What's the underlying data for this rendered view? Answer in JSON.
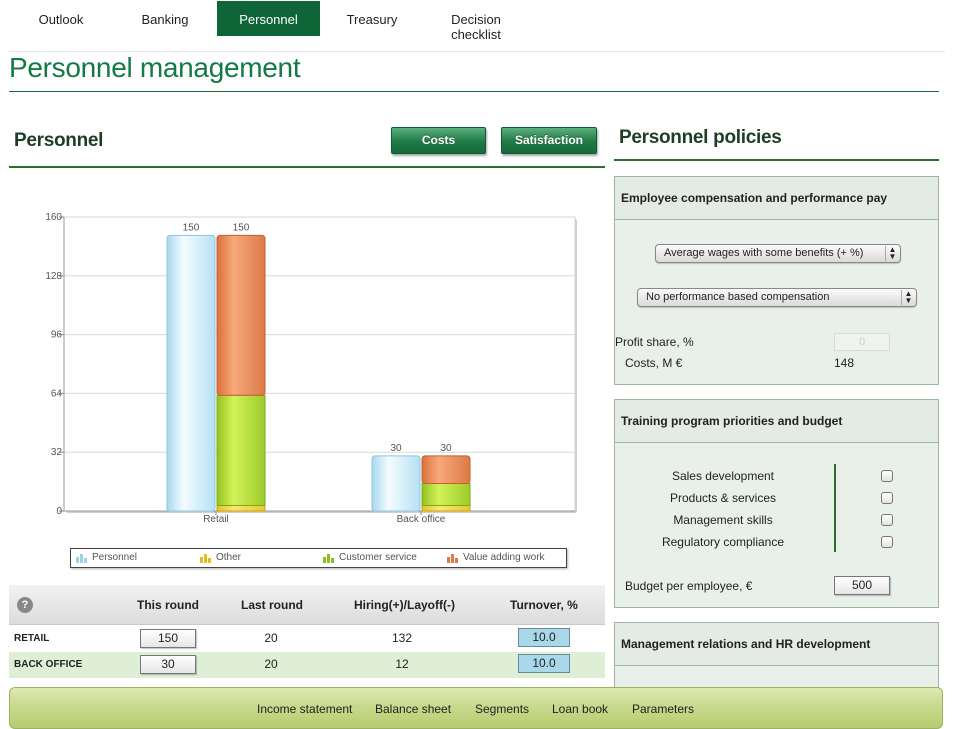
{
  "nav": {
    "tabs": [
      {
        "label": "Outlook"
      },
      {
        "label": "Banking"
      },
      {
        "label": "Personnel",
        "active": true
      },
      {
        "label": "Treasury"
      },
      {
        "label": "Decision\nchecklist"
      }
    ]
  },
  "page_title": "Personnel management",
  "personnel": {
    "title": "Personnel",
    "costs_button": "Costs",
    "satisfaction_button": "Satisfaction"
  },
  "chart_data": {
    "type": "bar",
    "stacked": true,
    "categories": [
      "Retail",
      "Back office"
    ],
    "ylim": [
      0,
      160
    ],
    "yticks": [
      0,
      32,
      64,
      96,
      128,
      160
    ],
    "series": [
      {
        "name": "Personnel",
        "color": "#bfe6f5",
        "values": [
          150,
          30
        ],
        "group": "personnel"
      },
      {
        "name": "Other",
        "color": "#f2d43a",
        "values": [
          3,
          3
        ],
        "group": "split"
      },
      {
        "name": "Customer service",
        "color": "#a9d43a",
        "values": [
          60,
          12
        ],
        "group": "split"
      },
      {
        "name": "Value adding work",
        "color": "#e98a55",
        "values": [
          87,
          15
        ],
        "group": "split"
      }
    ],
    "bar_labels": {
      "personnel": [
        150,
        30
      ],
      "split": [
        150,
        30
      ]
    },
    "grid": true,
    "legend_position": "bottom"
  },
  "table": {
    "help_icon": "?",
    "headers": [
      "This round",
      "Last round",
      "Hiring(+)/Layoff(-)",
      "Turnover, %"
    ],
    "rows": [
      {
        "label": "RETAIL",
        "this_round": "150",
        "last_round": "20",
        "hiring": "132",
        "turnover": "10.0"
      },
      {
        "label": "BACK OFFICE",
        "this_round": "30",
        "last_round": "20",
        "hiring": "12",
        "turnover": "10.0"
      }
    ]
  },
  "policies": {
    "title": "Personnel policies",
    "compensation": {
      "title": "Employee compensation and performance pay",
      "wages_select": "Average wages with some benefits (+ %)",
      "performance_select": "No performance based compensation",
      "profit_share_label": "Profit share, %",
      "profit_share_value": "0",
      "costs_label": "Costs, M €",
      "costs_value": "148"
    },
    "training": {
      "title": "Training program priorities and budget",
      "items": [
        "Sales development",
        "Products & services",
        "Management skills",
        "Regulatory compliance"
      ],
      "budget_label": "Budget per employee, €",
      "budget_value": "500"
    },
    "management": {
      "title": "Management relations and HR development"
    }
  },
  "bottom_nav": [
    "Income statement",
    "Balance sheet",
    "Segments",
    "Loan book",
    "Parameters"
  ]
}
